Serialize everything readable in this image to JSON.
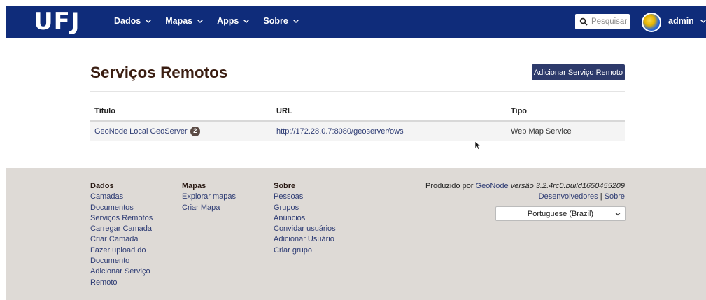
{
  "navbar": {
    "logo": "UFJ",
    "menu": [
      {
        "label": "Dados"
      },
      {
        "label": "Mapas"
      },
      {
        "label": "Apps"
      },
      {
        "label": "Sobre"
      }
    ],
    "search_placeholder": "Pesquisar",
    "user": "admin",
    "bg_color": "#0f2c7a"
  },
  "page": {
    "title": "Serviços Remotos",
    "add_button": "Adicionar Serviço Remoto"
  },
  "table": {
    "headers": [
      "Título",
      "URL",
      "Tipo"
    ],
    "rows": [
      {
        "title": "GeoNode Local GeoServer",
        "badge": "2",
        "url": "http://172.28.0.7:8080/geoserver/ows",
        "type": "Web Map Service"
      }
    ]
  },
  "footer": {
    "columns": [
      {
        "heading": "Dados",
        "links": [
          "Camadas",
          "Documentos",
          "Serviços Remotos",
          "Carregar Camada",
          "Criar Camada",
          "Fazer upload do",
          "Documento",
          "Adicionar Serviço",
          "Remoto"
        ]
      },
      {
        "heading": "Mapas",
        "links": [
          "Explorar mapas",
          "Criar Mapa"
        ]
      },
      {
        "heading": "Sobre",
        "links": [
          "Pessoas",
          "Grupos",
          "Anúncios",
          "Convidar usuários",
          "Adicionar Usuário",
          "Criar grupo"
        ]
      }
    ],
    "produced_by": "Produzido por",
    "geonode": "GeoNode",
    "version": "versão 3.2.4rc0.build1650455209",
    "developers": "Desenvolvedores",
    "separator": "|",
    "about": "Sobre",
    "language": "Portuguese (Brazil)",
    "bg_color": "#dedad6"
  }
}
